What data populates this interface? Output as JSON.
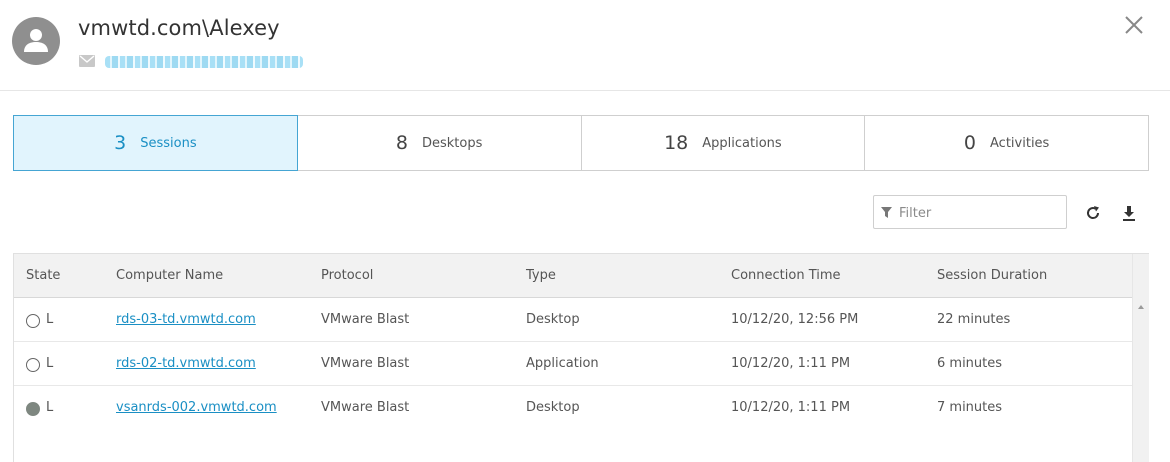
{
  "header": {
    "user_name": "vmwtd.com\\Alexey",
    "close_label": "×"
  },
  "tabs": [
    {
      "count": "3",
      "label": "Sessions",
      "active": true
    },
    {
      "count": "8",
      "label": "Desktops",
      "active": false
    },
    {
      "count": "18",
      "label": "Applications",
      "active": false
    },
    {
      "count": "0",
      "label": "Activities",
      "active": false
    }
  ],
  "toolbar": {
    "filter_placeholder": "Filter"
  },
  "table": {
    "columns": [
      "State",
      "Computer Name",
      "Protocol",
      "Type",
      "Connection Time",
      "Session Duration"
    ],
    "rows": [
      {
        "state": "L",
        "state_style": "empty",
        "computer": "rds-03-td.vmwtd.com",
        "protocol": "VMware Blast",
        "type": "Desktop",
        "connection_time": "10/12/20, 12:56 PM",
        "duration": "22 minutes"
      },
      {
        "state": "L",
        "state_style": "empty",
        "computer": "rds-02-td.vmwtd.com",
        "protocol": "VMware Blast",
        "type": "Application",
        "connection_time": "10/12/20, 1:11 PM",
        "duration": "6 minutes"
      },
      {
        "state": "L",
        "state_style": "filled",
        "computer": "vsanrds-002.vmwtd.com",
        "protocol": "VMware Blast",
        "type": "Desktop",
        "connection_time": "10/12/20, 1:11 PM",
        "duration": "7 minutes"
      }
    ]
  },
  "colors": {
    "accent": "#1a8fc4",
    "active_tab_bg": "#e1f4fd",
    "avatar": "#8f8f8f"
  },
  "icons": [
    "user-icon",
    "mail-icon",
    "close-icon",
    "filter-icon",
    "refresh-icon",
    "download-icon"
  ]
}
